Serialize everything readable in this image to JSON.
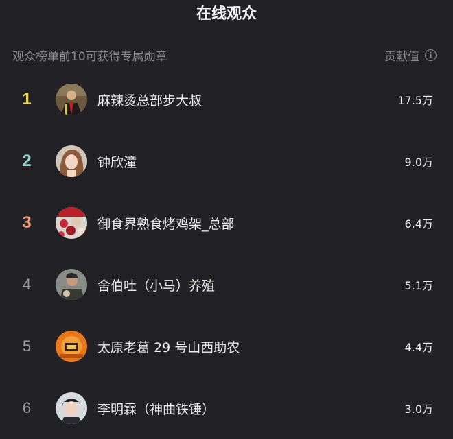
{
  "header": {
    "title": "在线观众"
  },
  "subheader": {
    "hint": "观众榜单前10可获得专属勋章",
    "metric_label": "贡献值",
    "info_icon": "info-icon"
  },
  "colors": {
    "background": "#222226",
    "rank_1": "#f3d34a",
    "rank_2": "#8fd3c9",
    "rank_3": "#f09a74",
    "rank_default": "#9a9a9e"
  },
  "viewers": [
    {
      "rank": "1",
      "name": "麻辣烫总部步大叔",
      "score": "17.5万"
    },
    {
      "rank": "2",
      "name": "钟欣潼",
      "score": "9.0万"
    },
    {
      "rank": "3",
      "name": "御食界熟食烤鸡架_总部",
      "score": "6.4万"
    },
    {
      "rank": "4",
      "name": "舍伯吐（小马）养殖",
      "score": "5.1万"
    },
    {
      "rank": "5",
      "name": "太原老葛 29 号山西助农",
      "score": "4.4万"
    },
    {
      "rank": "6",
      "name": "李明霖（神曲铁锤）",
      "score": "3.0万"
    }
  ]
}
